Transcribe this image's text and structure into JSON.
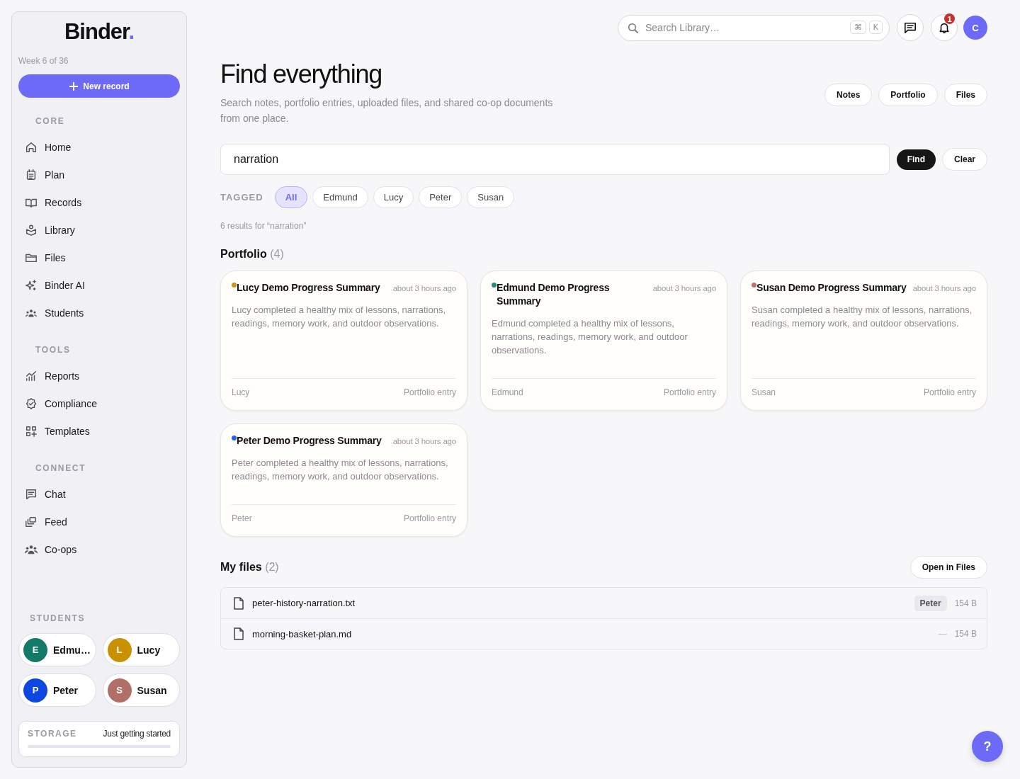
{
  "sidebar": {
    "logo": "Binder",
    "logo_dot": ".",
    "week": "Week 6 of 36",
    "new_button": "New record",
    "sections": [
      {
        "title": "CORE",
        "items": [
          {
            "label": "Home",
            "kind": "home"
          },
          {
            "label": "Plan",
            "kind": "plan"
          },
          {
            "label": "Records",
            "kind": "records"
          },
          {
            "label": "Library",
            "kind": "library"
          },
          {
            "label": "Files",
            "kind": "files"
          },
          {
            "label": "Binder AI",
            "kind": "ai"
          },
          {
            "label": "Students",
            "kind": "students"
          }
        ]
      },
      {
        "title": "TOOLS",
        "items": [
          {
            "label": "Reports",
            "kind": "reports"
          },
          {
            "label": "Compliance",
            "kind": "compliance"
          },
          {
            "label": "Templates",
            "kind": "templates"
          }
        ]
      },
      {
        "title": "CONNECT",
        "items": [
          {
            "label": "Chat",
            "kind": "chat"
          },
          {
            "label": "Feed",
            "kind": "feed"
          },
          {
            "label": "Co-ops",
            "kind": "coops"
          }
        ]
      }
    ],
    "students_title": "STUDENTS",
    "students": [
      {
        "initial": "E",
        "name": "Edmu…",
        "color": "#137a67"
      },
      {
        "initial": "L",
        "name": "Lucy",
        "color": "#c99100"
      },
      {
        "initial": "P",
        "name": "Peter",
        "color": "#0d47e0"
      },
      {
        "initial": "S",
        "name": "Susan",
        "color": "#b07068"
      }
    ],
    "storage": {
      "label": "STORAGE",
      "status": "Just getting started",
      "level": 0
    }
  },
  "topbar": {
    "search_placeholder": "Search Library…",
    "keys": [
      "⌘",
      "K"
    ],
    "notifications": "1",
    "avatar": "C"
  },
  "header": {
    "title": "Find everything",
    "subtitle": "Search notes, portfolio entries, uploaded files, and shared co-op documents from one place.",
    "quick_links": [
      "Notes",
      "Portfolio",
      "Files"
    ]
  },
  "search": {
    "value": "narration",
    "find": "Find",
    "clear": "Clear"
  },
  "filters": {
    "label": "TAGGED",
    "tags": [
      {
        "label": "All",
        "selected": true
      },
      {
        "label": "Edmund",
        "selected": false
      },
      {
        "label": "Lucy",
        "selected": false
      },
      {
        "label": "Peter",
        "selected": false
      },
      {
        "label": "Susan",
        "selected": false
      }
    ]
  },
  "results_count": "6 results for “narration”",
  "portfolio": {
    "title": "Portfolio",
    "count": "(4)",
    "cards": [
      {
        "title": "Lucy Demo Progress Summary",
        "time": "about 3 hours ago",
        "color": "#c9961a",
        "body": "Lucy completed a healthy mix of lessons, narrations, readings, memory work, and outdoor observations.",
        "student": "Lucy",
        "type": "Portfolio entry"
      },
      {
        "title": "Edmund Demo Progress Summary",
        "time": "about 3 hours ago",
        "color": "#2a8a7a",
        "body": "Edmund completed a healthy mix of lessons, narrations, readings, memory work, and outdoor observations.",
        "student": "Edmund",
        "type": "Portfolio entry"
      },
      {
        "title": "Susan Demo Progress Summary",
        "time": "about 3 hours ago",
        "color": "#b9756c",
        "body": "Susan completed a healthy mix of lessons, narrations, readings, memory work, and outdoor observations.",
        "student": "Susan",
        "type": "Portfolio entry"
      },
      {
        "title": "Peter Demo Progress Summary",
        "time": "about 3 hours ago",
        "color": "#2563eb",
        "body": "Peter completed a healthy mix of lessons, narrations, readings, memory work, and outdoor observations.",
        "student": "Peter",
        "type": "Portfolio entry"
      }
    ]
  },
  "files": {
    "title": "My files",
    "count": "(2)",
    "open_button": "Open in Files",
    "rows": [
      {
        "name": "peter-history-narration.txt",
        "tag": "Peter",
        "kind": "tagged",
        "size": "154 B"
      },
      {
        "name": "morning-basket-plan.md",
        "tag": "—",
        "kind": "untagged",
        "size": "154 B"
      }
    ]
  },
  "help": "?"
}
